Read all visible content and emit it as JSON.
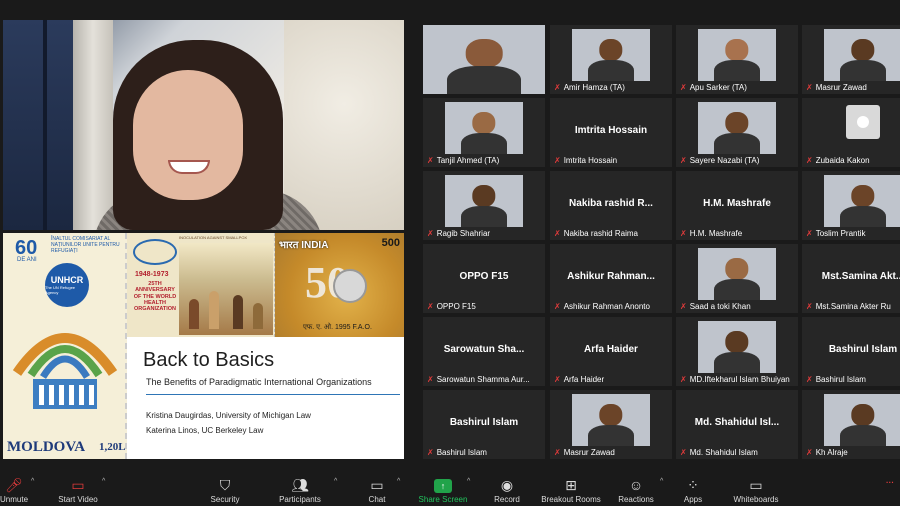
{
  "speaker": {
    "tag": ""
  },
  "slide": {
    "title": "Back to Basics",
    "subtitle": "The Benefits of Paradigmatic International Organizations",
    "author1": "Kristina Daugirdas, University of Michigan Law",
    "author2": "Katerina Linos, UC Berkeley Law",
    "stamp_unhcr": {
      "number": "60",
      "sub": "DE ANI",
      "top_text": "ÎNALTUL COMISARIAT AL NAȚIUNILOR UNITE PENTRU REFUGIAȚI",
      "logo": "UNHCR",
      "logo_sub": "The UN Refugee Agency",
      "country": "MOLDOVA",
      "value": "1,20L"
    },
    "stamp_who": {
      "inoculation": "INOCULATION AGAINST SMALLPOX",
      "years": "1948-1973",
      "anniversary": "25TH ANNIVERSARY OF THE WORLD HEALTH ORGANIZATION"
    },
    "stamp_fao": {
      "country": "भारत INDIA",
      "value": "500",
      "fifty": "50",
      "caption": "एफ. ए. ओ. 1995 F.A.O."
    }
  },
  "participants": [
    {
      "name": "",
      "label": "",
      "has_video": true,
      "muted": false
    },
    {
      "name": "",
      "label": "Amir Hamza (TA)",
      "has_video": true,
      "muted": true
    },
    {
      "name": "",
      "label": "Apu Sarker (TA)",
      "has_video": true,
      "muted": true
    },
    {
      "name": "",
      "label": "Masrur Zawad",
      "has_video": true,
      "muted": true
    },
    {
      "name": "",
      "label": "Tanjil Ahmed (TA)",
      "has_video": true,
      "muted": true
    },
    {
      "name": "Imtrita Hossain",
      "label": "Imtrita Hossain",
      "has_video": false,
      "muted": true
    },
    {
      "name": "",
      "label": "Sayere Nazabi (TA)",
      "has_video": true,
      "muted": true
    },
    {
      "name": "",
      "label": "Zubaida Kakon",
      "has_video": false,
      "muted": true,
      "avatar": true
    },
    {
      "name": "",
      "label": "Ragib Shahriar",
      "has_video": true,
      "muted": true
    },
    {
      "name": "Nakiba rashid R...",
      "label": "Nakiba rashid Raima",
      "has_video": false,
      "muted": true
    },
    {
      "name": "H.M. Mashrafe",
      "label": "H.M. Mashrafe",
      "has_video": false,
      "muted": true
    },
    {
      "name": "",
      "label": "Toslim Prantik",
      "has_video": true,
      "muted": true
    },
    {
      "name": "OPPO F15",
      "label": "OPPO F15",
      "has_video": false,
      "muted": true
    },
    {
      "name": "Ashikur Rahman...",
      "label": "Ashikur Rahman Anonto",
      "has_video": false,
      "muted": true
    },
    {
      "name": "",
      "label": "Saad a toki Khan",
      "has_video": true,
      "muted": true
    },
    {
      "name": "Mst.Samina Akt...",
      "label": "Mst.Samina Akter Ru",
      "has_video": false,
      "muted": true
    },
    {
      "name": "Sarowatun Sha...",
      "label": "Sarowatun Shamma Aur...",
      "has_video": false,
      "muted": true
    },
    {
      "name": "Arfa Haider",
      "label": "Arfa Haider",
      "has_video": false,
      "muted": true
    },
    {
      "name": "",
      "label": "MD.Iftekharul Islam Bhuiyan",
      "has_video": true,
      "muted": true
    },
    {
      "name": "Bashirul Islam",
      "label": "Bashirul Islam",
      "has_video": false,
      "muted": true
    },
    {
      "name": "Bashirul Islam",
      "label": "Bashirul Islam",
      "has_video": false,
      "muted": true
    },
    {
      "name": "",
      "label": "Masrur Zawad",
      "has_video": true,
      "muted": true
    },
    {
      "name": "Md. Shahidul Isl...",
      "label": "Md. Shahidul Islam",
      "has_video": false,
      "muted": true
    },
    {
      "name": "",
      "label": "Kh Alraje",
      "has_video": true,
      "muted": true
    }
  ],
  "toolbar": {
    "unmute": "Unmute",
    "start_video": "Start Video",
    "security": "Security",
    "participants": "Participants",
    "participants_count": "",
    "chat": "Chat",
    "share_screen": "Share Screen",
    "record": "Record",
    "breakout_rooms": "Breakout Rooms",
    "reactions": "Reactions",
    "apps": "Apps",
    "whiteboards": "Whiteboards"
  },
  "colors": {
    "background": "#1a1a1a",
    "tile": "#262626",
    "muted": "#e23b3b",
    "share": "#21a34a",
    "accent_rule": "#2e75b6"
  }
}
